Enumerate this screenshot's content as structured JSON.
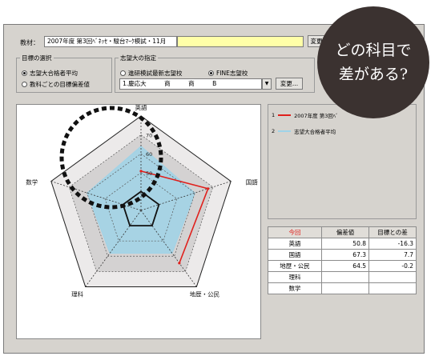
{
  "toolbar": {
    "material_label": "教材：",
    "material_value": "2007年度 第3回ﾍﾞﾈｯｾ・駿台ﾏｰｸ模試・11月",
    "change_button": "変更"
  },
  "target_group": {
    "title": "目標の選択",
    "options": [
      "志望大合格者平均",
      "教科ごとの目標偏差値"
    ],
    "selected": 0
  },
  "univ_group": {
    "title": "志望大の指定",
    "options": [
      "進研模試最新志望校",
      "FINE志望校"
    ],
    "selected": 1,
    "dropdown_value": "1.慶応大　　　商　　　商　　　B",
    "change_button": "変更..."
  },
  "legend": {
    "entries": [
      {
        "num": "1",
        "label": "2007年度 第3回ﾍﾞ",
        "color": "#e0201c"
      },
      {
        "num": "2",
        "label": "志望大合格者平均",
        "color": "#9fd3e8"
      }
    ]
  },
  "chart_data": {
    "type": "radar",
    "axes": [
      "英語",
      "国語",
      "地歴・公民",
      "理科",
      "数学"
    ],
    "scale_labels": [
      "70",
      "60",
      "50"
    ],
    "rmin": 30,
    "rmax": 80,
    "series": [
      {
        "name": "2007年度 第3回ﾍﾞ",
        "values": [
          50.8,
          67.3,
          64.5,
          null,
          null
        ],
        "color": "#e0201c"
      },
      {
        "name": "志望大合格者平均",
        "values": [
          64,
          60,
          58,
          58,
          60
        ],
        "color": "#9fd3e8"
      }
    ]
  },
  "score_table": {
    "headers": [
      "今回",
      "偏差値",
      "目標との差"
    ],
    "rows": [
      {
        "subject": "英語",
        "value": "50.8",
        "diff": "-16.3"
      },
      {
        "subject": "国語",
        "value": "67.3",
        "diff": "7.7"
      },
      {
        "subject": "地歴・公民",
        "value": "64.5",
        "diff": "-0.2"
      },
      {
        "subject": "理科",
        "value": "",
        "diff": ""
      },
      {
        "subject": "数学",
        "value": "",
        "diff": ""
      }
    ]
  },
  "bubble": {
    "line1": "どの科目で",
    "line2": "差がある?"
  },
  "colors": {
    "highlight_dashed": "#111111",
    "header_red": "#e0201c"
  }
}
